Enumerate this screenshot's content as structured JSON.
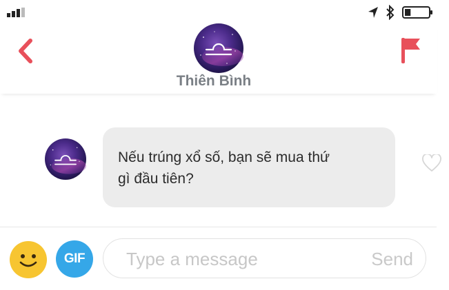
{
  "status_bar": {
    "signal_icon": "signal-bars-icon",
    "location_icon": "location-arrow-icon",
    "bluetooth_icon": "bluetooth-icon",
    "battery_icon": "battery-icon",
    "battery_level": 0.25
  },
  "header": {
    "contact_name": "Thiên Bình",
    "back_icon": "chevron-left-icon",
    "flag_icon": "flag-icon",
    "avatar_icon": "libra-zodiac-icon",
    "accent_color": "#e8505b"
  },
  "messages": [
    {
      "sender": "Thiên Bình",
      "lines": [
        "Nếu trúng xổ số, bạn sẽ mua thứ",
        "gì đầu tiên?"
      ],
      "like_icon": "heart-outline-icon"
    }
  ],
  "composer": {
    "emoji_icon": "smiley-face-icon",
    "gif_label": "GIF",
    "placeholder": "Type a message",
    "send_label": "Send",
    "gif_color": "#35a7e8",
    "emoji_color": "#f7c531"
  }
}
